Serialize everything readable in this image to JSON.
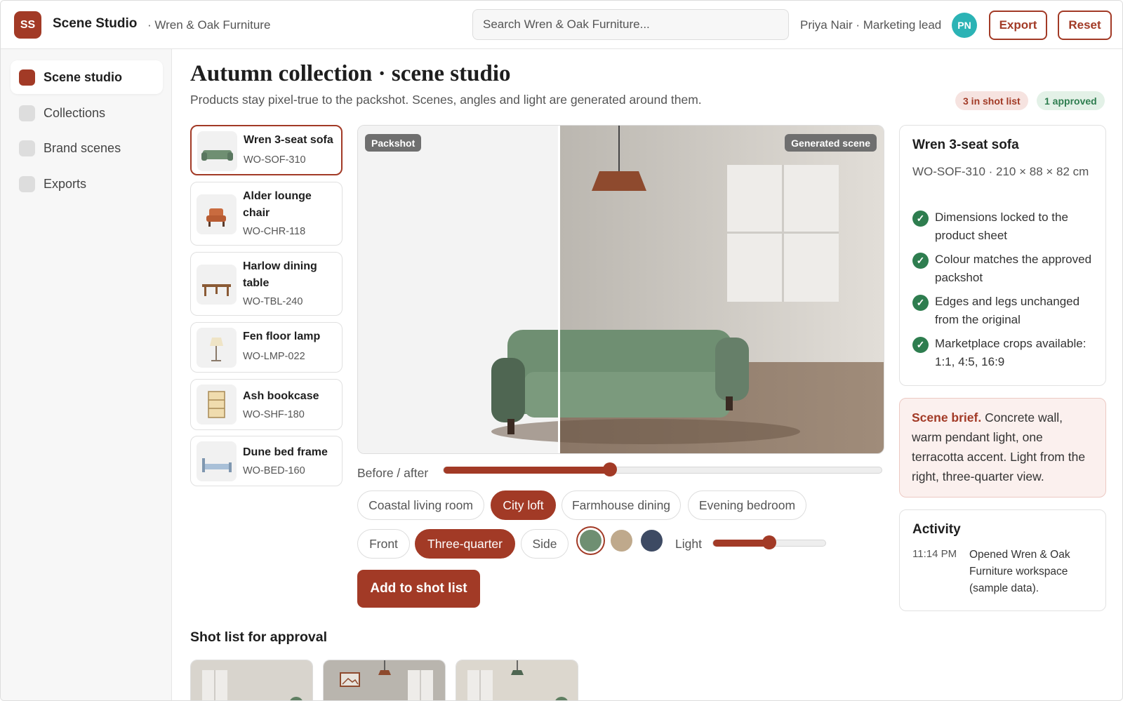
{
  "header": {
    "logo": "SS",
    "app_name": "Scene Studio",
    "org": "· Wren & Oak Furniture",
    "search_placeholder": "Search Wren & Oak Furniture...",
    "user": "Priya Nair · Marketing lead",
    "avatar": "PN",
    "export": "Export",
    "reset": "Reset"
  },
  "sidebar": {
    "items": [
      {
        "label": "Scene studio",
        "active": true
      },
      {
        "label": "Collections"
      },
      {
        "label": "Brand scenes"
      },
      {
        "label": "Exports"
      }
    ]
  },
  "page": {
    "title": "Autumn collection · scene studio",
    "subtitle": "Products stay pixel-true to the packshot. Scenes, angles and light are generated around them.",
    "badge_shotlist": "3 in shot list",
    "badge_approved": "1 approved"
  },
  "products": [
    {
      "name": "Wren 3-seat sofa",
      "sku": "WO-SOF-310",
      "icon": "sofa-icon"
    },
    {
      "name": "Alder lounge chair",
      "sku": "WO-CHR-118",
      "icon": "chair-icon"
    },
    {
      "name": "Harlow dining table",
      "sku": "WO-TBL-240",
      "icon": "table-icon"
    },
    {
      "name": "Fen floor lamp",
      "sku": "WO-LMP-022",
      "icon": "lamp-icon"
    },
    {
      "name": "Ash bookcase",
      "sku": "WO-SHF-180",
      "icon": "bookcase-icon"
    },
    {
      "name": "Dune bed frame",
      "sku": "WO-BED-160",
      "icon": "bed-icon"
    }
  ],
  "stage": {
    "packshot_label": "Packshot",
    "generated_label": "Generated scene",
    "before_after_label": "Before / after",
    "before_after_value": 0.38
  },
  "scenes": [
    "Coastal living room",
    "City loft",
    "Farmhouse dining",
    "Evening bedroom"
  ],
  "selected_scene": "City loft",
  "angles": [
    "Front",
    "Three-quarter",
    "Side"
  ],
  "selected_angle": "Three-quarter",
  "swatches": [
    "#6f8f72",
    "#bfa98c",
    "#3d4a63"
  ],
  "light": {
    "label": "Light",
    "value": 0.5
  },
  "add_button": "Add to shot list",
  "detail": {
    "name": "Wren 3-seat sofa",
    "spec": "WO-SOF-310 · 210 × 88 × 82 cm",
    "checks": [
      "Dimensions locked to the product sheet",
      "Colour matches the approved packshot",
      "Edges and legs unchanged from the original",
      "Marketplace crops available: 1:1, 4:5, 16:9"
    ]
  },
  "brief": {
    "label": "Scene brief.",
    "text": " Concrete wall, warm pendant light, one terracotta accent. Light from the right, three-quarter view."
  },
  "activity": {
    "title": "Activity",
    "time": "11:14 PM",
    "text": "Opened Wren & Oak Furniture workspace (sample data)."
  },
  "shotlist": {
    "title": "Shot list for approval"
  },
  "colors": {
    "accent": "#a23a26",
    "sofa": "#6f8f72",
    "success": "#2e7d4f"
  }
}
